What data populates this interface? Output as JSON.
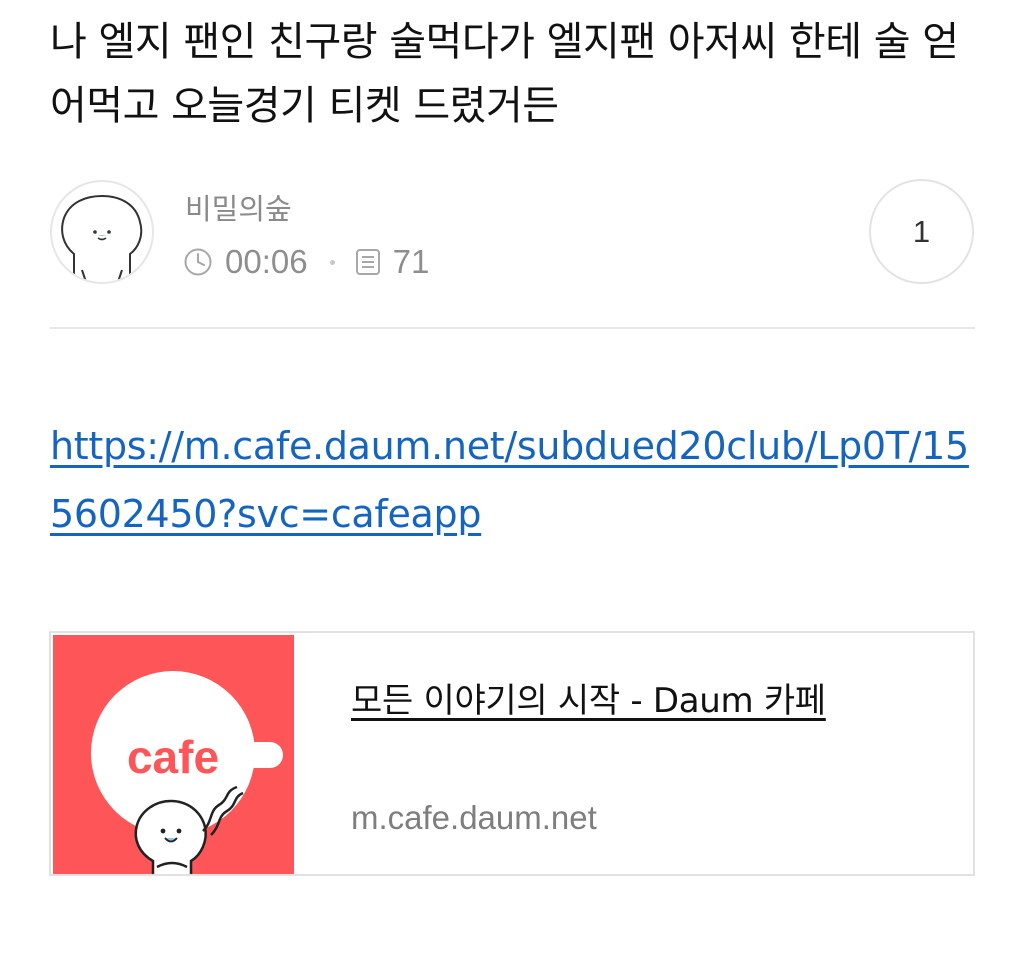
{
  "post": {
    "title": "나 엘지 팬인 친구랑 술먹다가 엘지팬 아저씨 한테 술 얻어먹고 오늘경기 티켓 드렸거든",
    "author": "비밀의숲",
    "time": "00:06",
    "views": "71",
    "comment_count": "1"
  },
  "body": {
    "link": "https://m.cafe.daum.net/subdued20club/Lp0T/155602450?svc=cafeapp"
  },
  "card": {
    "logo_text": "cafe",
    "title": "모든 이야기의 시작 - Daum 카페",
    "url": "m.cafe.daum.net"
  },
  "icons": {
    "avatar": "seal-character-avatar",
    "time": "clock-icon",
    "views": "document-icon"
  },
  "colors": {
    "link": "#1565c0",
    "card_accent": "#fd5558",
    "meta_text": "#8e8e8e"
  }
}
